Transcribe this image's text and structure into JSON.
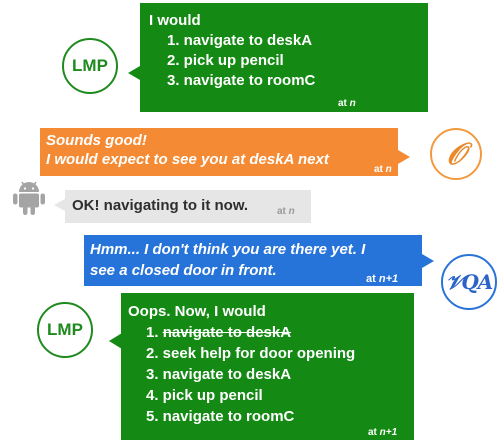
{
  "avatars": {
    "lmp_1": "LMP",
    "orange": "𝒪",
    "blue": "𝒱QA",
    "lmp_2": "LMP"
  },
  "msg1": {
    "intro": "I would",
    "steps": [
      "1. navigate to deskA",
      "2. pick up pencil",
      "3. navigate to roomC"
    ],
    "stamp_prefix": "at ",
    "stamp_var": "n"
  },
  "msg2": {
    "line1": "Sounds good!",
    "line2": "I would expect to see you at deskA next",
    "stamp_prefix": "at ",
    "stamp_var": "n"
  },
  "msg3": {
    "text": "OK! navigating to it now.",
    "stamp_prefix": "at ",
    "stamp_var": "n"
  },
  "msg4": {
    "line1": "Hmm... I don't think you are there yet. I",
    "line2": "see a closed door in front.",
    "stamp_prefix": "at ",
    "stamp_var": "n+1"
  },
  "msg5": {
    "intro": "Oops. Now, I would",
    "step1_num": "1. ",
    "step1_text": "navigate to deskA",
    "steps": [
      "2. seek help for door opening",
      "3. navigate to deskA",
      "4. pick up pencil",
      "5. navigate to roomC"
    ],
    "stamp_prefix": "at ",
    "stamp_var": "n+1"
  },
  "colors": {
    "green": "#148a14",
    "orange": "#f48a33",
    "blue": "#2673d9",
    "gray": "#e6e6e6"
  },
  "icons": {
    "robot": "android-robot-icon"
  }
}
